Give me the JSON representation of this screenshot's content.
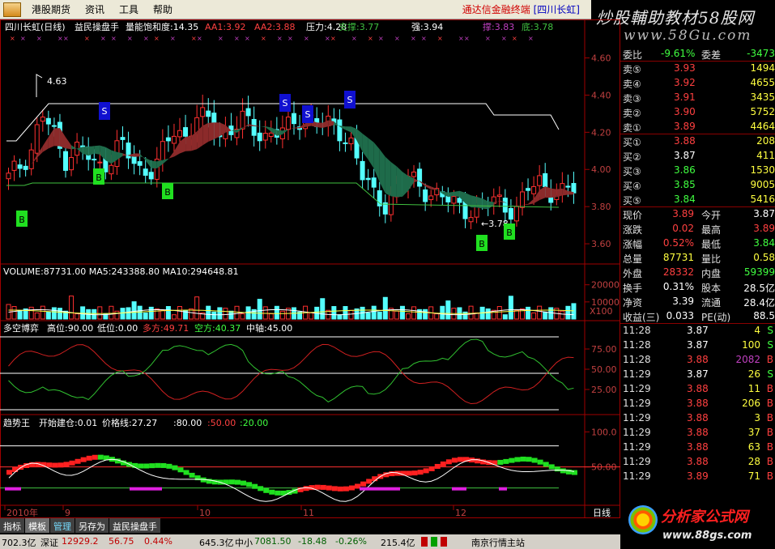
{
  "menu": {
    "items": [
      "港股期货",
      "资讯",
      "工具",
      "帮助"
    ],
    "terminal_name": "通达信金融终端",
    "stock_tag": "[四川长虹]"
  },
  "brand": {
    "title": "炒股輔助教材58股网",
    "url": "www.58Gu.com"
  },
  "main_panel": {
    "header": [
      {
        "text": "四川长虹(日线)",
        "color": "#ffffff"
      },
      {
        "text": "益民操盘手",
        "color": "#ffffff"
      },
      {
        "text": "量能饱和度:14.35",
        "color": "#ffffff"
      },
      {
        "text": "AA1:3.92",
        "color": "#ff4040"
      },
      {
        "text": "AA2:3.88",
        "color": "#ff4040"
      },
      {
        "text": "压力:4.28",
        "color": "#ffffff"
      },
      {
        "text": "支撑:3.77",
        "color": "#40c040"
      },
      {
        "text": "强:3.94",
        "color": "#ffffff"
      },
      {
        "text": "撑:3.83",
        "color": "#c040c0"
      },
      {
        "text": "底:3.78",
        "color": "#40c040"
      }
    ],
    "y_ticks": [
      "4.60",
      "4.40",
      "4.20",
      "4.00",
      "3.80",
      "3.60"
    ],
    "price_high_label": "4.63",
    "price_low_label": "←3.78",
    "buy_marker": "B",
    "sell_marker": "S"
  },
  "volume_panel": {
    "header": "VOLUME:87731.00  MA5:243388.80  MA10:294648.81",
    "y_ticks": [
      "20000",
      "10000"
    ],
    "unit": "X100"
  },
  "game_panel": {
    "name": "多空博弈",
    "high": "高位:90.00",
    "low": "低位:0.00",
    "bull": "多方:49.71",
    "bear": "空方:40.37",
    "mid": "中轴:45.00",
    "y_ticks": [
      "75.00",
      "50.00",
      "25.00"
    ]
  },
  "trend_panel": {
    "name": "趋势王",
    "entry": "开始建仓:0.01",
    "price_line": "价格线:27.27",
    "v1": ":80.00",
    "v2": ":50.00",
    "v3": ":20.00",
    "y_ticks": [
      "100.0",
      "50.00"
    ]
  },
  "time_axis": {
    "labels": [
      "2010年",
      "9",
      "10",
      "11",
      "12"
    ],
    "period": "日线"
  },
  "quote": {
    "wei_bi_label": "委比",
    "wei_bi": "-9.61%",
    "wei_cha_label": "委差",
    "wei_cha": "-3473",
    "asks": [
      {
        "label": "卖⑤",
        "price": "3.93",
        "vol": "1494"
      },
      {
        "label": "卖④",
        "price": "3.92",
        "vol": "4655"
      },
      {
        "label": "卖③",
        "price": "3.91",
        "vol": "3435"
      },
      {
        "label": "卖②",
        "price": "3.90",
        "vol": "5752"
      },
      {
        "label": "卖①",
        "price": "3.89",
        "vol": "4464"
      }
    ],
    "bids": [
      {
        "label": "买①",
        "price": "3.88",
        "vol": "208"
      },
      {
        "label": "买②",
        "price": "3.87",
        "vol": "411"
      },
      {
        "label": "买③",
        "price": "3.86",
        "vol": "1530"
      },
      {
        "label": "买④",
        "price": "3.85",
        "vol": "9005"
      },
      {
        "label": "买⑤",
        "price": "3.84",
        "vol": "5416"
      }
    ],
    "stats": [
      {
        "l1": "现价",
        "v1": "3.89",
        "c1": "#ff4040",
        "l2": "今开",
        "v2": "3.87",
        "c2": "#ffffff"
      },
      {
        "l1": "涨跌",
        "v1": "0.02",
        "c1": "#ff4040",
        "l2": "最高",
        "v2": "3.89",
        "c2": "#ff4040"
      },
      {
        "l1": "涨幅",
        "v1": "0.52%",
        "c1": "#ff4040",
        "l2": "最低",
        "v2": "3.84",
        "c2": "#40ff40"
      },
      {
        "l1": "总量",
        "v1": "87731",
        "c1": "#ffff40",
        "l2": "量比",
        "v2": "0.58",
        "c2": "#ffff40"
      },
      {
        "l1": "外盘",
        "v1": "28332",
        "c1": "#ff4040",
        "l2": "内盘",
        "v2": "59399",
        "c2": "#40ff40"
      },
      {
        "l1": "换手",
        "v1": "0.31%",
        "c1": "#ffffff",
        "l2": "股本",
        "v2": "28.5亿",
        "c2": "#ffffff"
      },
      {
        "l1": "净资",
        "v1": "3.39",
        "c1": "#ffffff",
        "l2": "流通",
        "v2": "28.4亿",
        "c2": "#ffffff"
      },
      {
        "l1": "收益(三)",
        "v1": "0.033",
        "c1": "#ffffff",
        "l2": "PE(动)",
        "v2": "88.5",
        "c2": "#ffffff"
      }
    ],
    "ticks": [
      {
        "time": "11:28",
        "price": "3.87",
        "pc": "#ffffff",
        "vol": "4",
        "flag": "S",
        "vc": "#ffff40",
        "fc": "#40ff40"
      },
      {
        "time": "11:28",
        "price": "3.87",
        "pc": "#ffffff",
        "vol": "100",
        "flag": "S",
        "vc": "#ffff40",
        "fc": "#40ff40"
      },
      {
        "time": "11:28",
        "price": "3.88",
        "pc": "#ff4040",
        "vol": "2082",
        "flag": "B",
        "vc": "#c040c0",
        "fc": "#ff4040"
      },
      {
        "time": "11:29",
        "price": "3.87",
        "pc": "#ffffff",
        "vol": "26",
        "flag": "S",
        "vc": "#ffff40",
        "fc": "#40ff40"
      },
      {
        "time": "11:29",
        "price": "3.88",
        "pc": "#ff4040",
        "vol": "11",
        "flag": "B",
        "vc": "#ffff40",
        "fc": "#ff4040"
      },
      {
        "time": "11:29",
        "price": "3.88",
        "pc": "#ff4040",
        "vol": "206",
        "flag": "B",
        "vc": "#ffff40",
        "fc": "#ff4040"
      },
      {
        "time": "11:29",
        "price": "3.88",
        "pc": "#ff4040",
        "vol": "3",
        "flag": "B",
        "vc": "#ffff40",
        "fc": "#ff4040"
      },
      {
        "time": "11:29",
        "price": "3.88",
        "pc": "#ff4040",
        "vol": "37",
        "flag": "B",
        "vc": "#ffff40",
        "fc": "#ff4040"
      },
      {
        "time": "11:29",
        "price": "3.88",
        "pc": "#ff4040",
        "vol": "63",
        "flag": "B",
        "vc": "#ffff40",
        "fc": "#ff4040"
      },
      {
        "time": "11:29",
        "price": "3.88",
        "pc": "#ff4040",
        "vol": "28",
        "flag": "B",
        "vc": "#ffff40",
        "fc": "#ff4040"
      },
      {
        "time": "11:29",
        "price": "3.89",
        "pc": "#ff4040",
        "vol": "71",
        "flag": "B",
        "vc": "#ffff40",
        "fc": "#ff4040"
      }
    ]
  },
  "tabs": [
    "指标",
    "模板",
    "管理",
    "另存为",
    "益民操盘手"
  ],
  "status": {
    "sh_amt": "702.3亿",
    "sz_label": "深证",
    "sz_val": "12929.2",
    "sz_chg": "56.75",
    "sz_pct": "0.44%",
    "sz_amt": "645.3亿",
    "zx_label": "中小",
    "zx_val": "7081.50",
    "zx_chg": "-18.48",
    "zx_pct": "-0.26%",
    "zx_amt": "215.4亿",
    "station": "南京行情主站"
  },
  "footer_logo": {
    "title": "分析家公式网",
    "url": "www.88gs.com"
  }
}
